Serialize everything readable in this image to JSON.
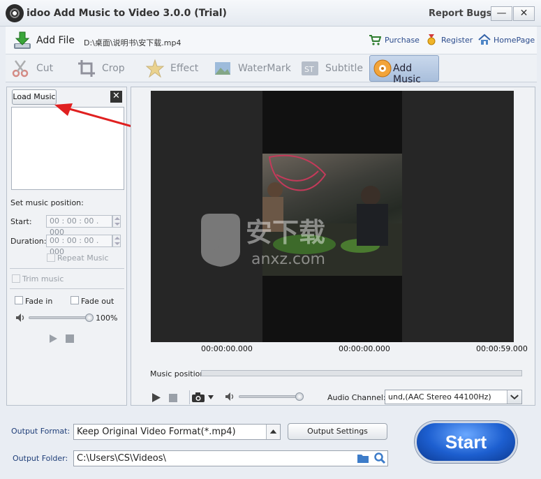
{
  "window": {
    "title": "idoo Add Music to Video 3.0.0 (Trial)",
    "report_bugs": "Report Bugs",
    "minimize": "—",
    "close": "✕"
  },
  "toolbar": {
    "add_file": "Add File",
    "file_path": "D:\\桌面\\说明书\\安下载.mp4",
    "purchase": "Purchase",
    "register": "Register",
    "homepage": "HomePage"
  },
  "tabs": [
    {
      "label": "Cut",
      "icon": "scissors-icon"
    },
    {
      "label": "Crop",
      "icon": "crop-icon"
    },
    {
      "label": "Effect",
      "icon": "star-icon"
    },
    {
      "label": "WaterMark",
      "icon": "watermark-icon"
    },
    {
      "label": "Subtitle",
      "icon": "subtitle-icon"
    },
    {
      "label": "Add Music",
      "icon": "music-disc-icon",
      "active": true
    }
  ],
  "left_panel": {
    "load_music": "Load Music",
    "close": "✕",
    "set_position": "Set music position:",
    "start_label": "Start:",
    "start_value": "00 : 00 : 00 . 000",
    "duration_label": "Duration:",
    "duration_value": "00 : 00 : 00 . 000",
    "repeat_music": "Repeat Music",
    "trim_music": "Trim music",
    "fade_in": "Fade in",
    "fade_out": "Fade out",
    "volume_percent": "100%",
    "volume_level": 1.0
  },
  "preview": {
    "time_start": "00:00:00.000",
    "time_current": "00:00:00.000",
    "time_end": "00:00:59.000",
    "music_position_label": "Music position:",
    "audio_channel_label": "Audio Channel:",
    "audio_channel_value": "und,(AAC Stereo 44100Hz)",
    "volume_level": 1.0,
    "watermark_text": "安下载",
    "watermark_sub": "anxz.com",
    "watermark_badge": "安"
  },
  "output": {
    "format_label": "Output Format:",
    "format_value": "Keep Original Video Format(*.mp4)",
    "settings_button": "Output Settings",
    "folder_label": "Output Folder:",
    "folder_value": "C:\\Users\\CS\\Videos\\",
    "start_button": "Start"
  },
  "colors": {
    "accent": "#1d5fd0",
    "active_tab": "#b3c8e4",
    "annotation_arrow": "#e02020"
  }
}
